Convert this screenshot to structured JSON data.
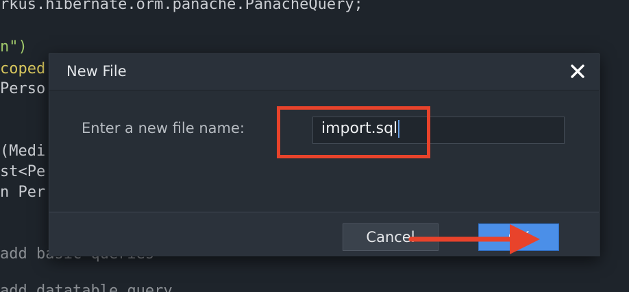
{
  "editor": {
    "lines": [
      "rkus.hibernate.orm.panache.PanacheQuery;",
      "n\")",
      "coped",
      "Perso",
      "(Medi",
      "st<Pe",
      "n Per",
      "add basic queries",
      "add datatable query"
    ]
  },
  "dialog": {
    "title": "New File",
    "field_label": "Enter a new file name:",
    "input_value": "import.sql",
    "cancel_label": "Cancel",
    "ok_label": "OK"
  },
  "colors": {
    "highlight": "#e8432b",
    "ok_button": "#4b8fe8"
  }
}
